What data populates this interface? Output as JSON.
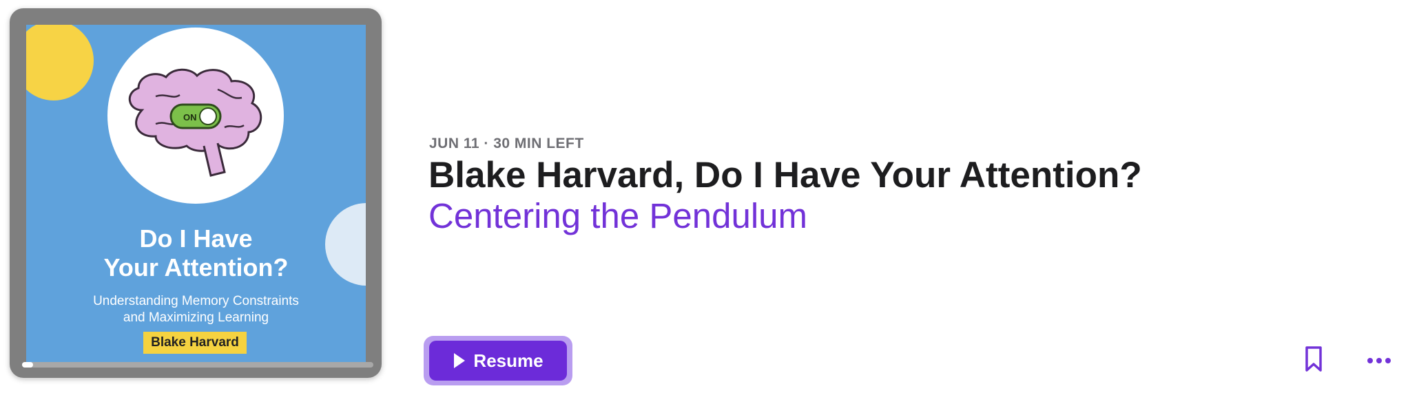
{
  "episode": {
    "meta": "JUN 11 · 30 MIN LEFT",
    "title": "Blake Harvard, Do I Have Your Attention?",
    "show": "Centering the Pendulum",
    "progress_fraction": 0.03
  },
  "artwork": {
    "switch_label": "ON",
    "title_line1": "Do I Have",
    "title_line2": "Your Attention?",
    "subtitle_line1": "Understanding Memory Constraints",
    "subtitle_line2": "and Maximizing Learning",
    "author": "Blake Harvard"
  },
  "actions": {
    "resume_label": "Resume",
    "play_icon": "play-icon",
    "bookmark_icon": "bookmark-icon",
    "more_icon": "more-icon"
  },
  "colors": {
    "accent": "#6c2bd9",
    "show_link": "#7232d8",
    "cover_background": "#5fa2dc",
    "author_badge": "#f5d240"
  }
}
